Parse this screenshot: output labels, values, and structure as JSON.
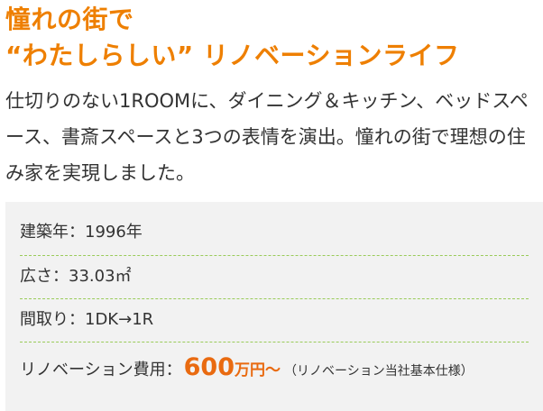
{
  "title": {
    "line1": "憧れの街で",
    "line2": "“わたしらしい” リノベーションライフ"
  },
  "intro": "仕切りのない1ROOMに、ダイニング＆キッチン、ベッドスペース、書斎スペースと3つの表情を演出。憧れの街で理想の住み家を実現しました。",
  "specs": {
    "built": "建築年：1996年",
    "area": "広さ：33.03㎡",
    "layout": "間取り：1DK→1R",
    "cost_label": "リノベーション費用：",
    "cost_value": "600",
    "cost_unit": "万円〜",
    "cost_note": "（リノベーション当社基本仕様）"
  },
  "colors": {
    "accent": "#ee7f00",
    "price": "#e96a10",
    "box_bg": "#f2f2f2",
    "divider": "#9acb5a"
  }
}
